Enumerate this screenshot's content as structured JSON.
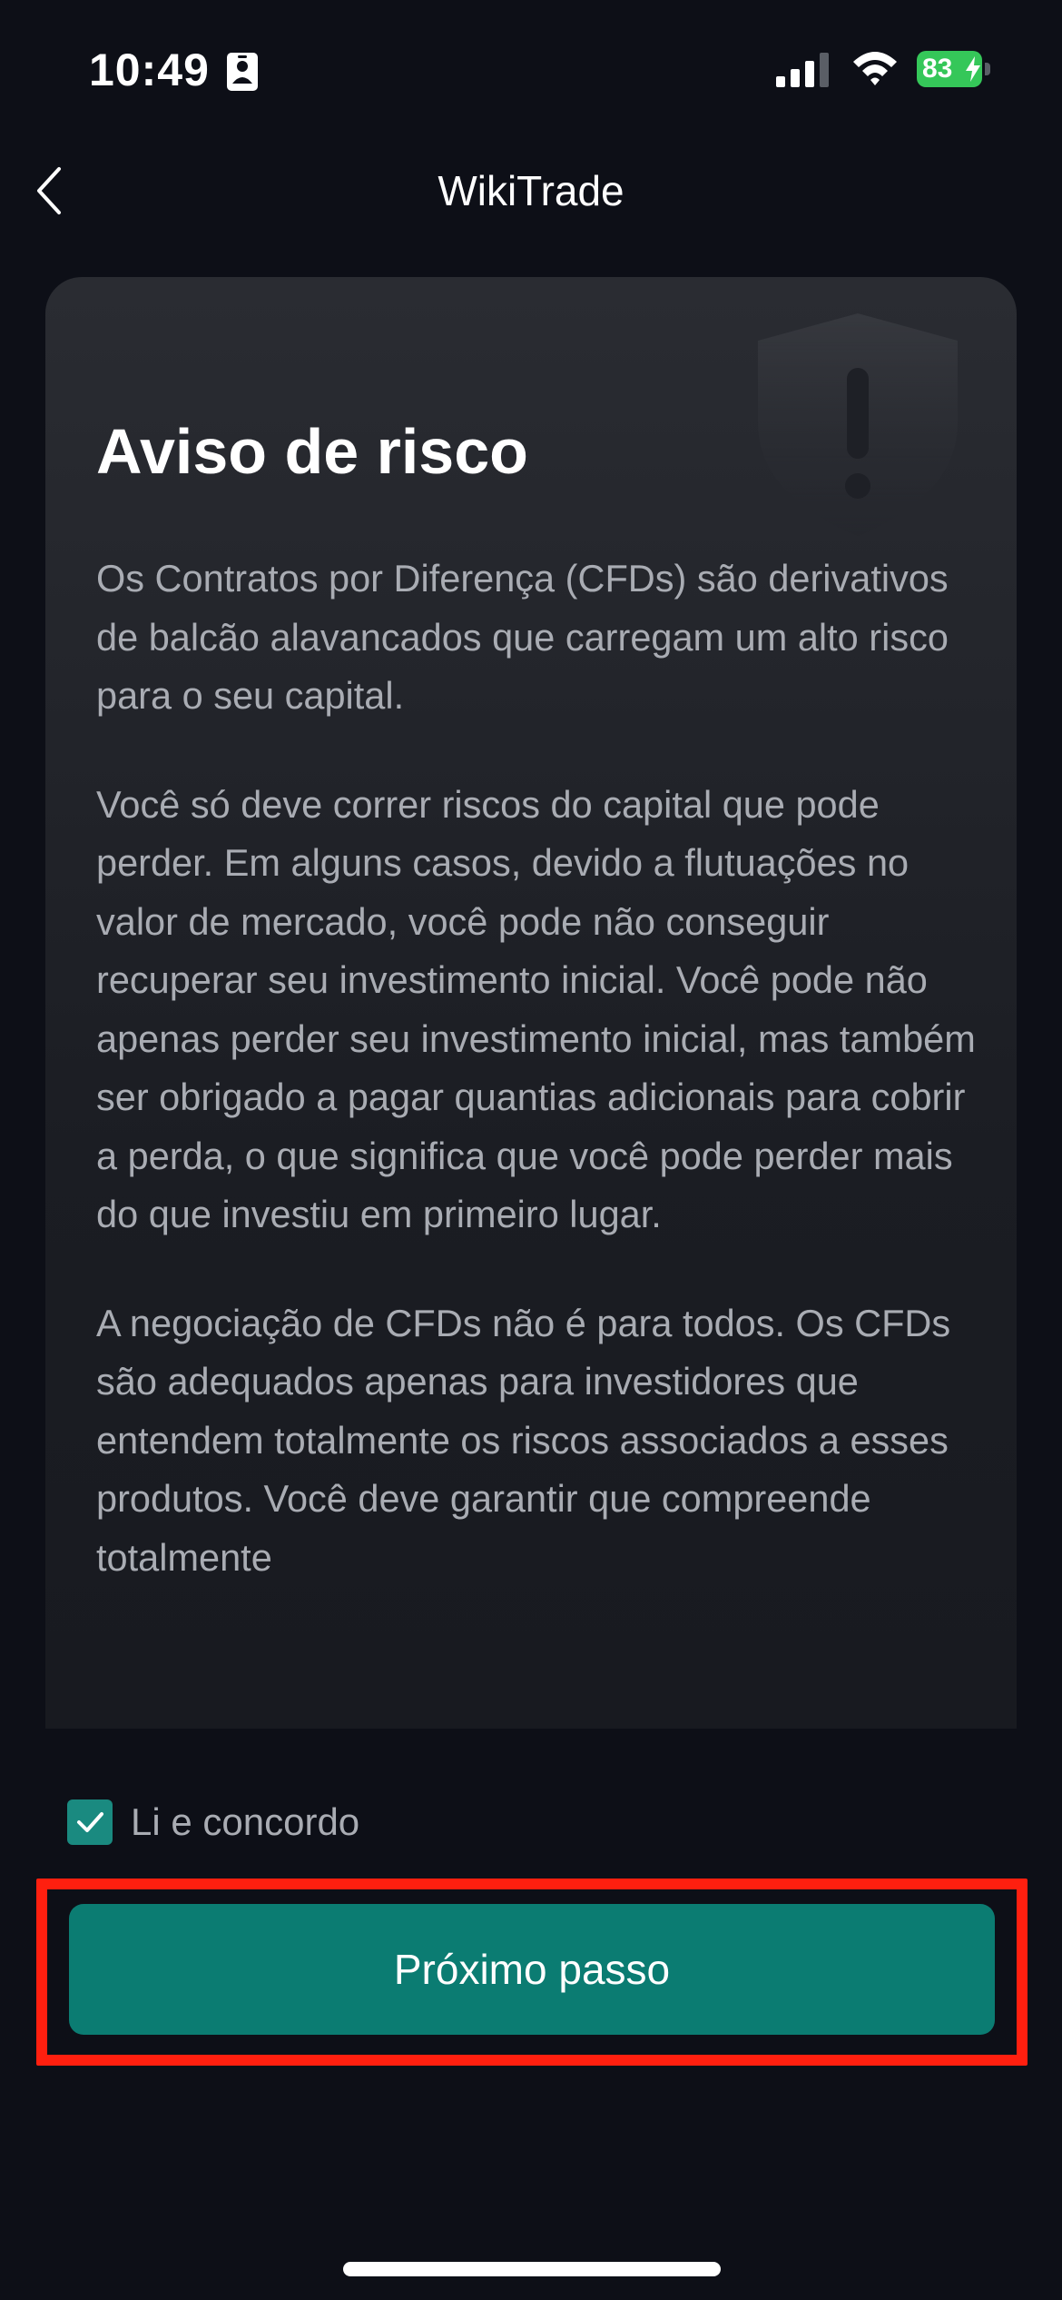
{
  "status_bar": {
    "time": "10:49",
    "battery_level": "83",
    "icons": [
      "id-card-icon",
      "signal-icon",
      "wifi-icon",
      "battery-charging-icon"
    ]
  },
  "nav": {
    "title": "WikiTrade",
    "back_icon": "chevron-left-icon"
  },
  "card": {
    "title": "Aviso de risco",
    "icon": "shield-warning-icon",
    "paragraphs": [
      "Os Contratos por Diferença (CFDs) são derivativos de balcão alavancados que carregam um alto risco para o seu capital.",
      "Você só deve correr riscos do capital que pode perder. Em alguns casos, devido a flutuações no valor de mercado, você pode não conseguir recuperar seu investimento inicial. Você pode não apenas perder seu investimento inicial, mas também ser obrigado a pagar quantias adicionais para cobrir a perda, o que significa que você pode perder mais do que investiu em primeiro lugar.",
      "A negociação de CFDs não é para todos. Os CFDs são adequados apenas para investidores que entendem totalmente os riscos associados a esses produtos. Você deve garantir que compreende totalmente"
    ]
  },
  "agree": {
    "label": "Li e concordo",
    "checked": true
  },
  "next_button": {
    "label": "Próximo passo"
  },
  "colors": {
    "background": "#0d0f17",
    "accent": "#0b7c72",
    "checkbox": "#1a8a80",
    "highlight": "#ff1f0f",
    "battery": "#35c759"
  }
}
